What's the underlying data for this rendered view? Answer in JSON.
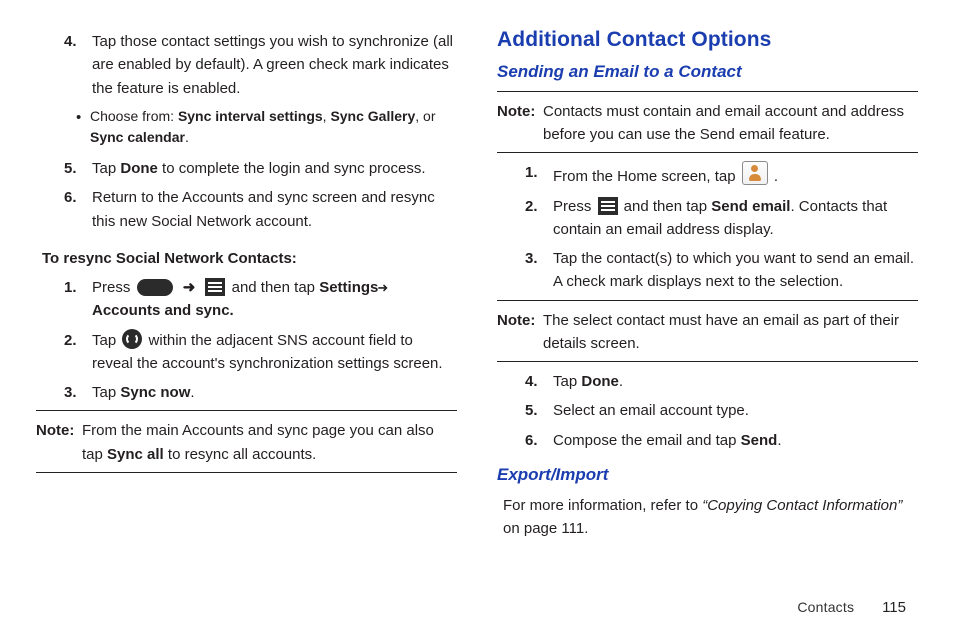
{
  "left": {
    "step4": {
      "num": "4.",
      "text": "Tap those contact settings you wish to synchronize (all are enabled by default). A green check mark indicates the feature is enabled."
    },
    "step4_bullet_lead": "Choose from: ",
    "step4_bullet_b1": "Sync interval settings",
    "step4_bullet_sep1": ", ",
    "step4_bullet_b2": "Sync Gallery",
    "step4_bullet_sep2": ", or ",
    "step4_bullet_b3": "Sync calendar",
    "step4_bullet_end": ".",
    "step5": {
      "num": "5.",
      "lead": "Tap ",
      "b": "Done",
      "tail": " to complete the login and sync process."
    },
    "step6": {
      "num": "6.",
      "text": "Return to the Accounts and sync screen and resync this new Social Network account."
    },
    "sub_heading": "To resync Social Network Contacts:",
    "resync1": {
      "num": "1.",
      "lead": "Press ",
      "mid": " and then tap ",
      "b1": "Settings",
      "b2": " Accounts and sync."
    },
    "resync2": {
      "num": "2.",
      "lead": "Tap ",
      "tail": " within the adjacent SNS account field to reveal the account's synchronization settings screen."
    },
    "resync3": {
      "num": "3.",
      "lead": "Tap ",
      "b": "Sync now",
      "end": "."
    },
    "note": {
      "label": "Note:",
      "lead": "From the main Accounts and sync page you can also tap ",
      "b": "Sync all",
      "tail": " to resync all accounts."
    }
  },
  "right": {
    "h1": "Additional Contact Options",
    "h2a": "Sending an Email to a Contact",
    "note1": {
      "label": "Note:",
      "text": "Contacts must contain and email account and address before you can use the Send email feature."
    },
    "step1": {
      "num": "1.",
      "lead": "From the Home screen, tap ",
      "end": " ."
    },
    "step2": {
      "num": "2.",
      "lead": "Press ",
      "mid": " and then tap ",
      "b": "Send email",
      "tail": ". Contacts that contain an email address display."
    },
    "step3": {
      "num": "3.",
      "text": "Tap the contact(s) to which you want to send an email. A check mark displays next to the selection."
    },
    "note2": {
      "label": "Note:",
      "text": "The select contact must have an email as part of their details screen."
    },
    "step4": {
      "num": "4.",
      "lead": "Tap ",
      "b": "Done",
      "end": "."
    },
    "step5": {
      "num": "5.",
      "text": "Select an email account type."
    },
    "step6": {
      "num": "6.",
      "lead": "Compose the email and tap ",
      "b": "Send",
      "end": "."
    },
    "h2b": "Export/Import",
    "export_lead": "For more information, refer to ",
    "export_ref": "“Copying Contact Information”",
    "export_tail": " on page 111."
  },
  "footer": {
    "section": "Contacts",
    "page": "115"
  },
  "arrows": {
    "big": "➜",
    "small": "➜"
  }
}
